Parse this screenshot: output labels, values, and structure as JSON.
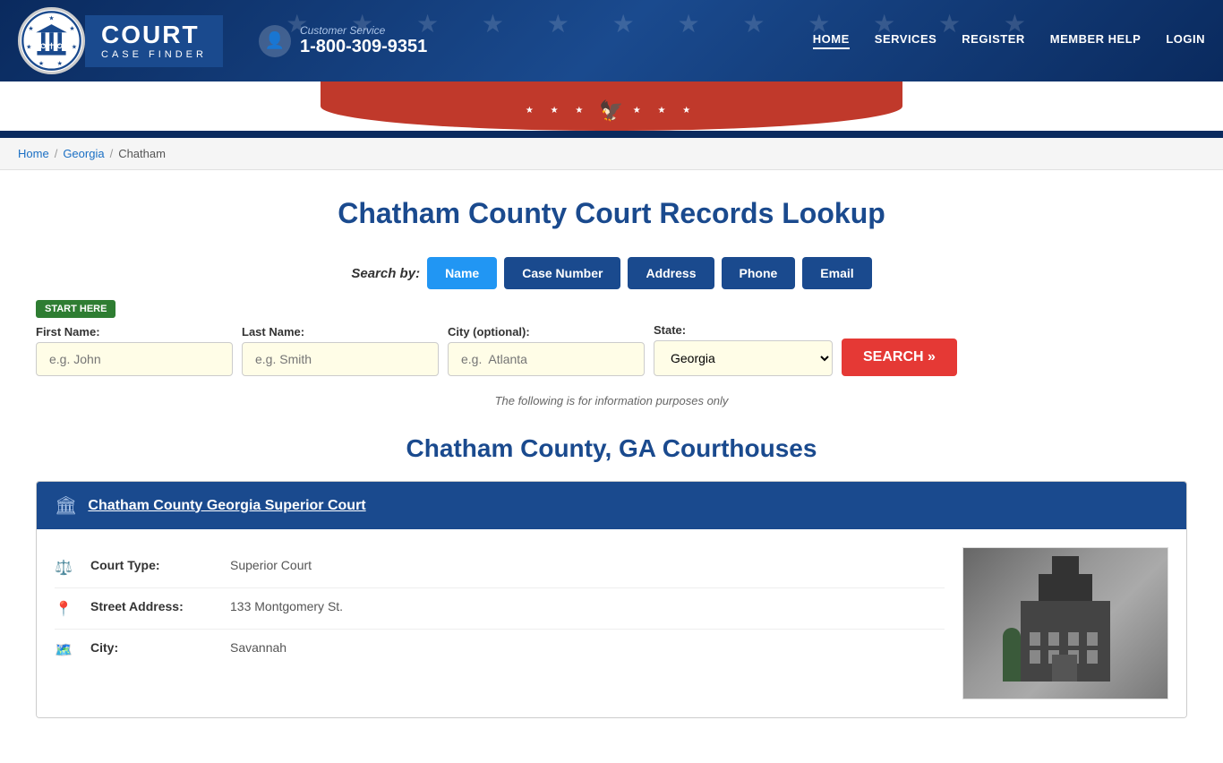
{
  "header": {
    "logo": {
      "court_text": "COURT",
      "case_finder_text": "CASE FINDER"
    },
    "phone": {
      "label": "Customer Service",
      "number": "1-800-309-9351"
    },
    "nav": {
      "items": [
        {
          "label": "HOME",
          "active": true
        },
        {
          "label": "SERVICES",
          "active": false
        },
        {
          "label": "REGISTER",
          "active": false
        },
        {
          "label": "MEMBER HELP",
          "active": false
        },
        {
          "label": "LOGIN",
          "active": false
        }
      ]
    }
  },
  "breadcrumb": {
    "home": "Home",
    "state": "Georgia",
    "county": "Chatham"
  },
  "main": {
    "page_title": "Chatham County Court Records Lookup",
    "search_by_label": "Search by:",
    "search_tabs": [
      {
        "label": "Name",
        "active": true
      },
      {
        "label": "Case Number",
        "active": false
      },
      {
        "label": "Address",
        "active": false
      },
      {
        "label": "Phone",
        "active": false
      },
      {
        "label": "Email",
        "active": false
      }
    ],
    "start_here_badge": "START HERE",
    "form": {
      "first_name_label": "First Name:",
      "first_name_placeholder": "e.g. John",
      "last_name_label": "Last Name:",
      "last_name_placeholder": "e.g. Smith",
      "city_label": "City (optional):",
      "city_placeholder": "e.g.  Atlanta",
      "state_label": "State:",
      "state_value": "Georgia",
      "search_button": "SEARCH »"
    },
    "info_note": "The following is for information purposes only",
    "courthouses_title": "Chatham County, GA Courthouses",
    "courthouse": {
      "title": "Chatham County Georgia Superior Court",
      "details": [
        {
          "icon": "⚖",
          "label": "Court Type:",
          "value": "Superior Court"
        },
        {
          "icon": "📍",
          "label": "Street Address:",
          "value": "133 Montgomery St."
        },
        {
          "icon": "🏛",
          "label": "City:",
          "value": "Savannah"
        }
      ]
    }
  }
}
